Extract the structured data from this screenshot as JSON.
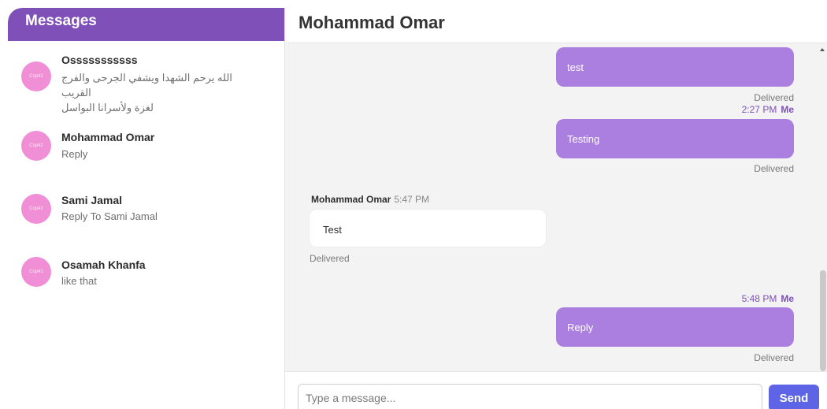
{
  "sidebar": {
    "title": "Messages",
    "avatar_text": "Cop42",
    "conversations": [
      {
        "name": "Osssssssssss",
        "preview_line1": "الله يرحم الشهدا ويشفي الجرحى والفرج القريب",
        "preview_line2": "لغزة ولأسرانا البواسل"
      },
      {
        "name": "Mohammad Omar",
        "preview": "Reply"
      },
      {
        "name": "Sami Jamal",
        "preview": "Reply To Sami Jamal"
      },
      {
        "name": "Osamah Khanfa",
        "preview": "like that"
      }
    ]
  },
  "chat": {
    "title": "Mohammad Omar",
    "messages": [
      {
        "direction": "out",
        "text": "test",
        "status": "Delivered"
      },
      {
        "direction": "out",
        "time": "2:27 PM",
        "sender": "Me",
        "text": "Testing",
        "status": "Delivered"
      },
      {
        "direction": "in",
        "sender": "Mohammad Omar",
        "time": "5:47 PM",
        "text": "Test",
        "status": "Delivered"
      },
      {
        "direction": "out",
        "time": "5:48 PM",
        "sender": "Me",
        "text": "Reply",
        "status": "Delivered"
      }
    ]
  },
  "composer": {
    "placeholder": "Type a message...",
    "value": "",
    "send_label": "Send"
  },
  "colors": {
    "accent": "#7e50b8",
    "outgoing_bubble": "#ab7fe0",
    "avatar": "#f08fd6",
    "send_button": "#5d64e6"
  }
}
